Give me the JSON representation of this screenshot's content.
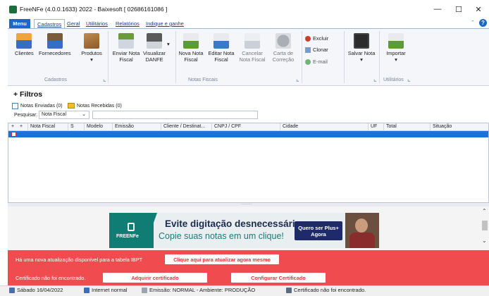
{
  "window": {
    "title": "FreeNFe (4.0.0.1633) 2022 - Baixesoft [ 02686161086 ]",
    "minimize": "—",
    "maximize": "☐",
    "close": "✕"
  },
  "ribbon_tabs": {
    "menu": "Menu",
    "tabs": [
      "Cadastros",
      "Geral",
      "Utilitários",
      "Relatórios",
      "Indique e ganhe"
    ],
    "active": "Cadastros",
    "collapse_glyph": "⌃",
    "help_glyph": "?"
  },
  "ribbon": {
    "cadastros": {
      "label": "Cadastros",
      "clientes": "Clientes",
      "fornecedores": "Fornecedores",
      "produtos": "Produtos"
    },
    "notas_fiscais": {
      "label": "Notas Fiscais",
      "enviar_1": "Enviar Nota",
      "enviar_2": "Fiscal",
      "visualizar_1": "Visualizar",
      "visualizar_2": "DANFE",
      "nova_1": "Nova Nota",
      "nova_2": "Fiscal",
      "editar_1": "Editar Nota",
      "editar_2": "Fiscal",
      "cancelar_1": "Cancelar",
      "cancelar_2": "Nota Fiscal",
      "carta_1": "Carta de",
      "carta_2": "Correção"
    },
    "acoes": {
      "excluir": "Excluir",
      "clonar": "Clonar",
      "email": "E-mail",
      "salvar": "Salvar Nota"
    },
    "utilitarios": {
      "label": "Utilitários",
      "importar": "Importar"
    },
    "dropdown_glyph": "▾",
    "launcher_glyph": "⊾"
  },
  "filters": {
    "title": "+ Filtros",
    "tab_enviadas": "Notas Enviadas (0)",
    "tab_recebidas": "Notas Recebidas (0)",
    "search_label": "Pesquisar:",
    "search_select": "Nota Fiscal",
    "search_value": ""
  },
  "grid": {
    "plus1": "+",
    "plus2": "+",
    "columns": [
      "Nota Fiscal",
      "S",
      "Modelo",
      "Emissão",
      "Cliente / Destinat...",
      "CNPJ / CPF",
      "Cidade",
      "UF",
      "Total",
      "Situação"
    ]
  },
  "banner": {
    "logo_text": "FREENFe",
    "headline": "Evite digitação desnecessária",
    "subline": "Copie suas notas em um clique!",
    "cta_1": "Quero ser Plus+",
    "cta_2": "Agora"
  },
  "alerts": {
    "ibpt_text": "Há uma nova atualização disponível para a tabela IBPT",
    "ibpt_button": "Clique aqui para atualizar agora mesmo",
    "cert_text": "Certificado não foi encontrado.",
    "cert_add_button": "Adquirir certificado",
    "cert_config_button": "Configurar Certificado"
  },
  "statusbar": {
    "date": "Sábado 16/04/2022",
    "internet": "Internet normal",
    "emissao": "Emissão: NORMAL - Ambiente: PRODUÇÃO",
    "certificado": "Certificado não foi encontrado."
  },
  "colors": {
    "accent": "#1967c7",
    "selection": "#1a74d6",
    "alert": "#f04c4f",
    "banner_teal": "#0f7d74",
    "banner_navy": "#1e2a6a"
  }
}
